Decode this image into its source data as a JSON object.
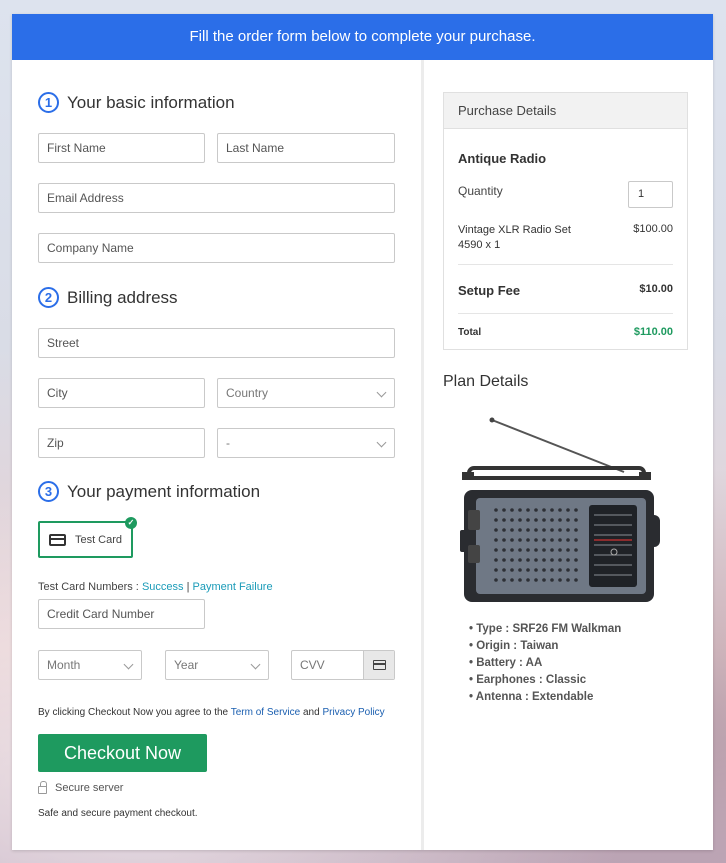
{
  "banner": {
    "text": "Fill the order form below to complete your purchase."
  },
  "sections": {
    "basic": {
      "num": "1",
      "title": "Your basic information"
    },
    "billing": {
      "num": "2",
      "title": "Billing address"
    },
    "payment": {
      "num": "3",
      "title": "Your payment information"
    }
  },
  "fields": {
    "first_name": "First Name",
    "last_name": "Last Name",
    "email": "Email Address",
    "company": "Company Name",
    "street": "Street",
    "city": "City",
    "country": "Country",
    "zip": "Zip",
    "state": "-",
    "card_number": "Credit Card Number",
    "month": "Month",
    "year": "Year",
    "cvv": "CVV"
  },
  "payment": {
    "test_card_label": "Test Card",
    "test_numbers_prefix": "Test Card Numbers :",
    "success_link": "Success",
    "separator": "|",
    "failure_link": "Payment Failure"
  },
  "agreement": {
    "prefix": "By clicking Checkout Now you agree to the",
    "terms_link": "Term of Service",
    "and": "and",
    "privacy_link": "Privacy Policy"
  },
  "checkout_button": "Checkout Now",
  "secure_server": "Secure server",
  "safe_text": "Safe and secure payment checkout.",
  "purchase": {
    "header": "Purchase Details",
    "product": "Antique Radio",
    "quantity_label": "Quantity",
    "quantity_value": "1",
    "item_line1": "Vintage XLR Radio Set",
    "item_line2": "4590 x 1",
    "item_price": "$100.00",
    "setup_label": "Setup Fee",
    "setup_price": "$10.00",
    "total_label": "Total",
    "total_price": "$110.00"
  },
  "plan": {
    "title": "Plan Details",
    "specs": [
      "Type : SRF26 FM Walkman",
      "Origin : Taiwan",
      "Battery : AA",
      "Earphones : Classic",
      "Antenna : Extendable"
    ]
  },
  "colors": {
    "banner": "#2b6ee8",
    "accent_green": "#1e9a5f",
    "link": "#1a9bb8"
  }
}
